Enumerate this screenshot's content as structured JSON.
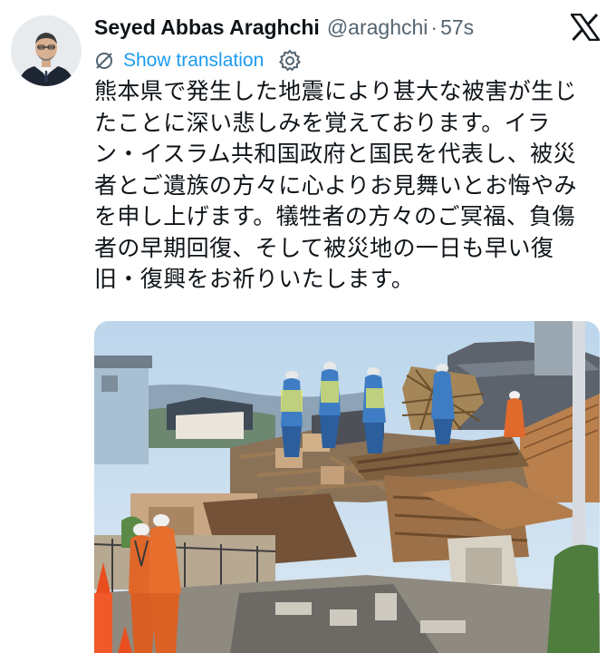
{
  "tweet": {
    "author_name": "Seyed Abbas Araghchi",
    "handle": "@araghchi",
    "separator": "·",
    "timestamp": "57s",
    "translate_label": "Show translation",
    "body_lines": [
      "熊本県で発生した地震により甚大な被害が生じ",
      "たことに深い悲しみを覚えております。イラ",
      "ン・イスラム共和国政府と国民を代表し、被災",
      "者とご遺族の方々に心よりお見舞いとお悔やみ",
      "を申し上げます。犠牲者の方々のご冥福、負傷",
      "者の早期回復、そして被災地の一日も早い復",
      "旧・復興をお祈りいたします。"
    ]
  },
  "icons": {
    "platform_logo": "x-logo-icon",
    "translate": "translate-icon",
    "settings": "gear-icon",
    "avatar": "avatar-photo"
  },
  "colors": {
    "text": "#0f1419",
    "secondary": "#536471",
    "link": "#1d9bf0",
    "background": "#ffffff"
  }
}
